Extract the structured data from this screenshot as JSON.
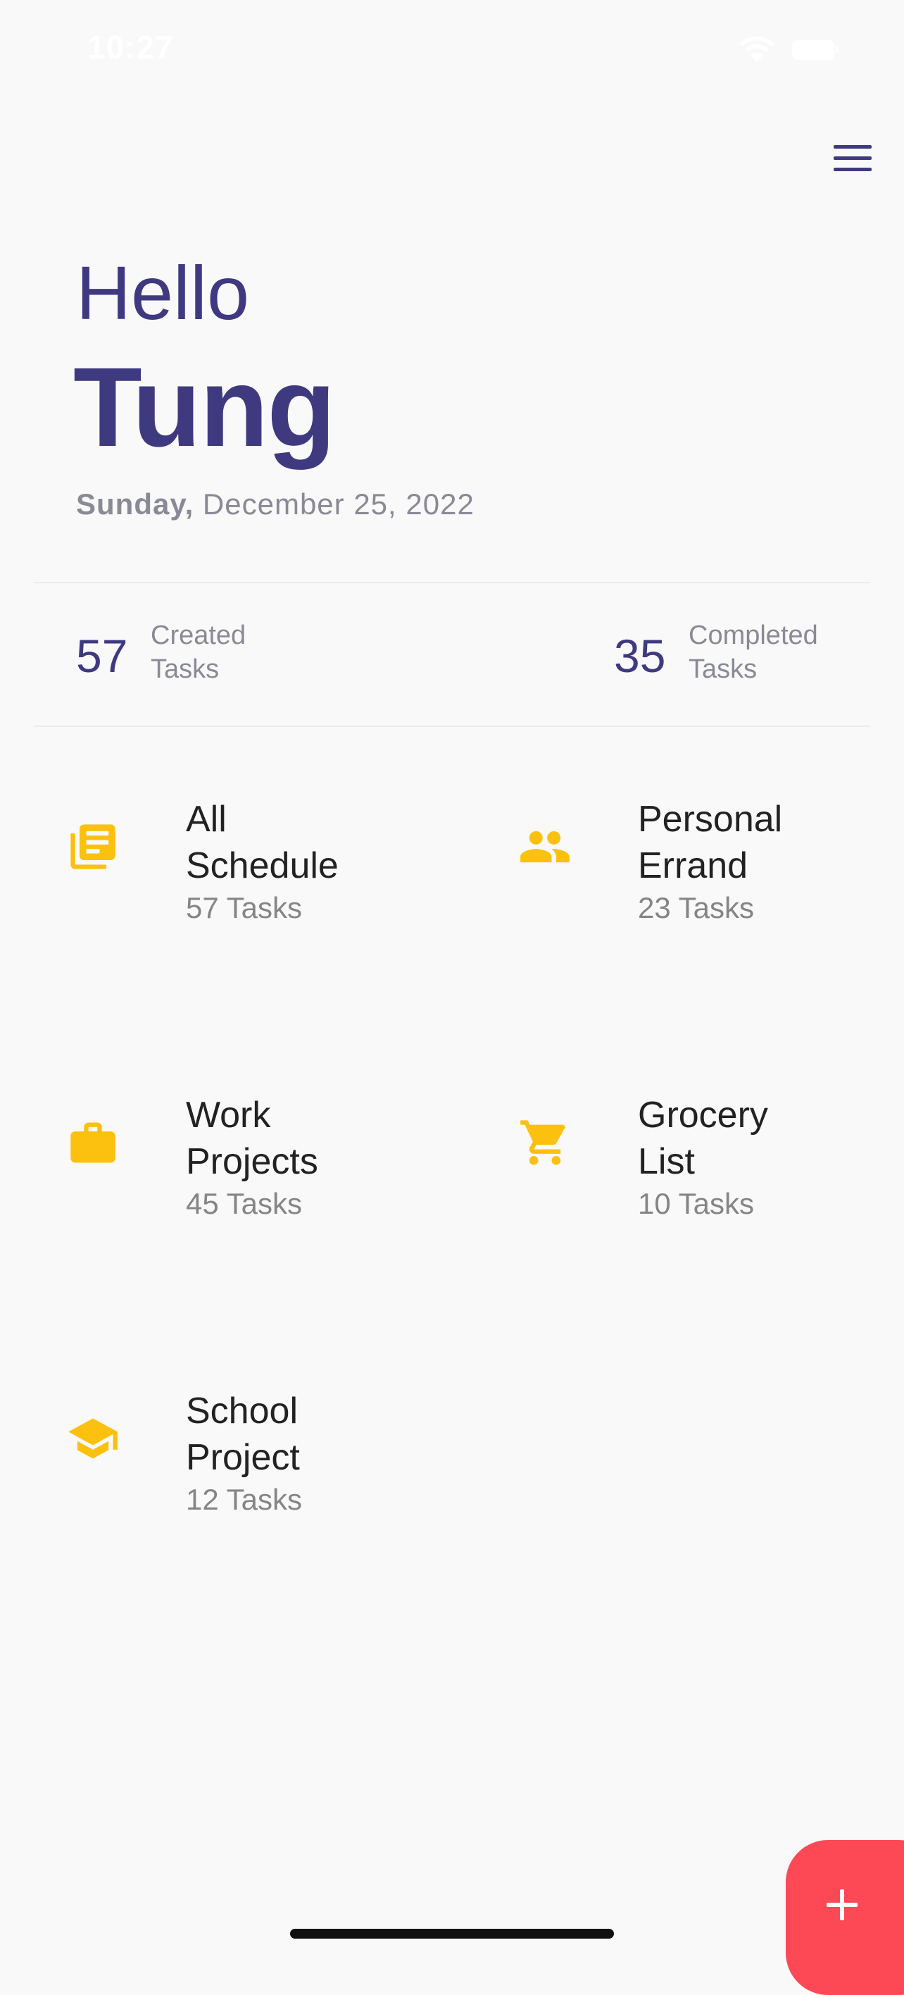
{
  "status_bar": {
    "time": "10:27"
  },
  "header": {
    "menu_icon": "hamburger-menu-icon",
    "greeting": "Hello",
    "user_name": "Tung",
    "date_day": "Sunday,",
    "date_rest": " December 25, 2022"
  },
  "stats": [
    {
      "value": "57",
      "label_line1": "Created",
      "label_line2": "Tasks"
    },
    {
      "value": "35",
      "label_line1": "Completed",
      "label_line2": "Tasks"
    }
  ],
  "categories": [
    {
      "title_line1": "All",
      "title_line2": "Schedule",
      "count": "57 Tasks",
      "icon": "schedule-list-icon"
    },
    {
      "title_line1": "Personal",
      "title_line2": "Errand",
      "count": "23 Tasks",
      "icon": "people-icon"
    },
    {
      "title_line1": "Work",
      "title_line2": "Projects",
      "count": "45 Tasks",
      "icon": "briefcase-icon"
    },
    {
      "title_line1": "Grocery",
      "title_line2": "List",
      "count": "10 Tasks",
      "icon": "shopping-cart-icon"
    },
    {
      "title_line1": "School",
      "title_line2": "Project",
      "count": "12 Tasks",
      "icon": "graduation-cap-icon"
    }
  ],
  "fab": {
    "icon": "plus-icon"
  },
  "colors": {
    "primary": "#3f3a80",
    "accent_icon": "#fcc00e",
    "fab": "#fd4955",
    "background": "#f9f9f9"
  }
}
